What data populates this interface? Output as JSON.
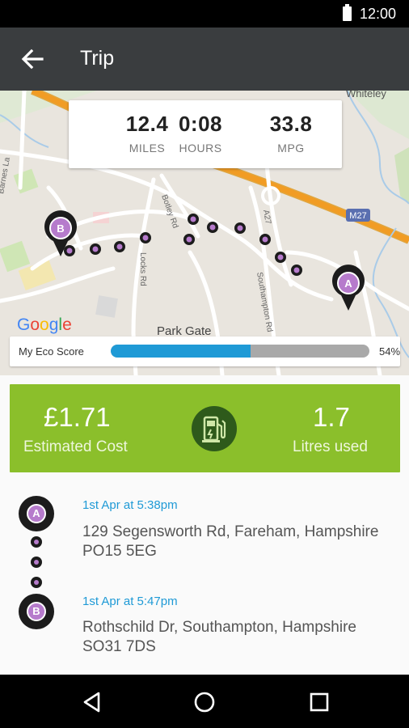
{
  "status_bar": {
    "time": "12:00"
  },
  "app_bar": {
    "title": "Trip"
  },
  "map": {
    "labels": {
      "whiteley": "Whiteley",
      "park_gate": "Park Gate",
      "m27": "M27",
      "botley_rd": "Botley Rd",
      "locks_rd": "Locks Rd",
      "southampton_rd": "Southampton Rd",
      "a27": "A27",
      "barnes_la": "Barnes La",
      "google": "Google"
    },
    "pin_a": "A",
    "pin_b": "B"
  },
  "stats": {
    "miles": {
      "value": "12.4",
      "label": "MILES"
    },
    "hours": {
      "value": "0:08",
      "label": "HOURS"
    },
    "mpg": {
      "value": "33.8",
      "label": "MPG"
    }
  },
  "eco_score": {
    "label": "My Eco Score",
    "percent": 54,
    "percent_text": "54%"
  },
  "cost": {
    "estimated_cost": "£1.71",
    "estimated_cost_label": "Estimated Cost",
    "litres": "1.7",
    "litres_label": "Litres used",
    "icon": "fuel-pump-icon"
  },
  "trip": {
    "start": {
      "pin": "A",
      "time": "1st Apr at 5:38pm",
      "address": "129 Segensworth Rd, Fareham, Hampshire PO15 5EG"
    },
    "end": {
      "pin": "B",
      "time": "1st Apr at 5:47pm",
      "address": "Rothschild Dr, Southampton, Hampshire SO31 7DS"
    }
  },
  "colors": {
    "app_bar": "#3a3d3f",
    "accent_blue": "#1f9ad6",
    "cost_green": "#8bbf2b",
    "pin_purple": "#b67bcc"
  }
}
